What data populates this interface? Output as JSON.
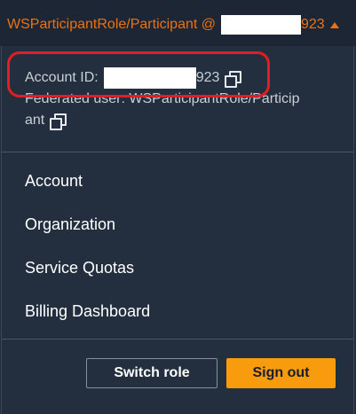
{
  "top_bar": {
    "role_label": "WSParticipantRole/Participant @",
    "account_suffix": "923"
  },
  "account_panel": {
    "account_id_label": "Account ID:",
    "account_id_suffix": "923",
    "federated_user_line1": "Federated user: WSParticipantRole/Particip",
    "federated_user_line2": "ant"
  },
  "menu": {
    "items": [
      {
        "label": "Account"
      },
      {
        "label": "Organization"
      },
      {
        "label": "Service Quotas"
      },
      {
        "label": "Billing Dashboard"
      }
    ]
  },
  "actions": {
    "switch_role_label": "Switch role",
    "sign_out_label": "Sign out"
  },
  "colors": {
    "accent_orange": "#ec7211",
    "sign_out_bg": "#f89c0e",
    "panel_bg": "#232f3e",
    "highlight_red": "#e02020"
  },
  "icons": {
    "copy": "copy-icon",
    "caret": "caret-up-icon"
  }
}
